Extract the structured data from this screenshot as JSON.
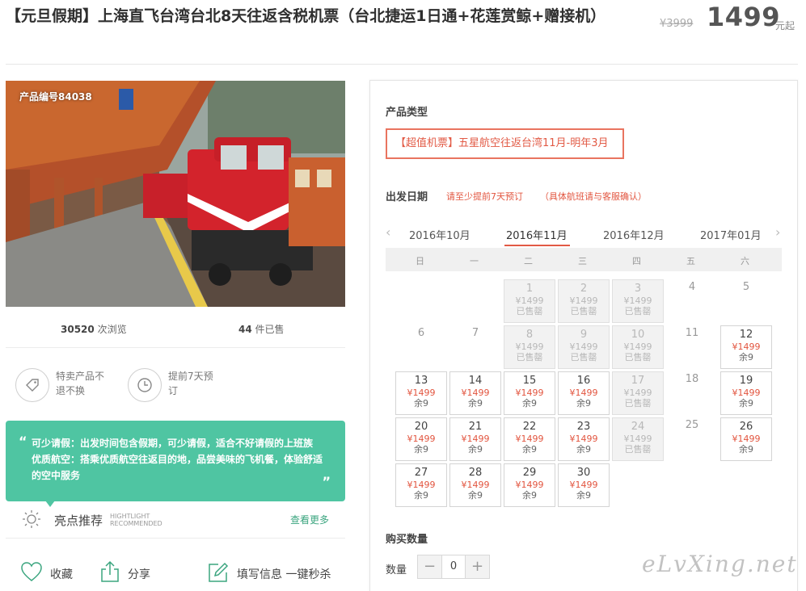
{
  "header": {
    "title": "【元旦假期】上海直飞台湾台北8天往返含税机票（台北捷运1日通+花莲赏鲸+赠接机）",
    "old_price": "¥3999",
    "price": "1499",
    "price_unit": "元起"
  },
  "product": {
    "number": "产品编号84038",
    "views": "30520",
    "views_label": "次浏览",
    "sold": "44",
    "sold_label": "件已售"
  },
  "features": [
    {
      "text": "特卖产品不退不换",
      "icon": "tag-icon"
    },
    {
      "text": "提前7天预订",
      "icon": "clock-icon"
    }
  ],
  "note": {
    "line1": "可少请假：出发时间包含假期，可少请假，适合不好请假的上班族",
    "line2": "优质航空：搭乘优质航空往返目的地，品尝美味的飞机餐，体验舒适的空中服务",
    "open_quote": "“",
    "close_quote": "”"
  },
  "highlight": {
    "title": "亮点推荐",
    "en_line1": "HIGHTLIGHT",
    "en_line2": "RECOMMENDED",
    "more": "查看更多"
  },
  "actions": {
    "favorite": "收藏",
    "share": "分享",
    "fill": "填写信息 一键秒杀"
  },
  "booking": {
    "type_label": "产品类型",
    "type_option": "【超值机票】五星航空往返台湾11月-明年3月",
    "date_label": "出发日期",
    "tip1": "请至少提前7天预订",
    "tip2": "（具体航班请与客服确认）",
    "months": [
      "2016年10月",
      "2016年11月",
      "2016年12月",
      "2017年01月"
    ],
    "weekdays": [
      "日",
      "一",
      "二",
      "三",
      "四",
      "五",
      "六"
    ],
    "price_tag": "¥1499",
    "sold_out": "已售罄",
    "remain": "余9",
    "qty_section": "购买数量",
    "qty_label": "数量",
    "qty_value": "0",
    "minus": "−",
    "plus": "+"
  },
  "calendar": [
    {
      "day": "1",
      "state": "sold"
    },
    {
      "day": "2",
      "state": "sold"
    },
    {
      "day": "3",
      "state": "sold"
    },
    {
      "day": "4",
      "state": "plain"
    },
    {
      "day": "5",
      "state": "plain"
    },
    {
      "day": "6",
      "state": "plain"
    },
    {
      "day": "7",
      "state": "plain"
    },
    {
      "day": "8",
      "state": "sold"
    },
    {
      "day": "9",
      "state": "sold"
    },
    {
      "day": "10",
      "state": "sold"
    },
    {
      "day": "11",
      "state": "plain"
    },
    {
      "day": "12",
      "state": "avail"
    },
    {
      "day": "13",
      "state": "avail"
    },
    {
      "day": "14",
      "state": "avail"
    },
    {
      "day": "15",
      "state": "avail"
    },
    {
      "day": "16",
      "state": "avail"
    },
    {
      "day": "17",
      "state": "sold"
    },
    {
      "day": "18",
      "state": "plain"
    },
    {
      "day": "19",
      "state": "avail"
    },
    {
      "day": "20",
      "state": "avail"
    },
    {
      "day": "21",
      "state": "avail"
    },
    {
      "day": "22",
      "state": "avail"
    },
    {
      "day": "23",
      "state": "avail"
    },
    {
      "day": "24",
      "state": "sold"
    },
    {
      "day": "25",
      "state": "plain"
    },
    {
      "day": "26",
      "state": "avail"
    },
    {
      "day": "27",
      "state": "avail"
    },
    {
      "day": "28",
      "state": "avail"
    },
    {
      "day": "29",
      "state": "avail"
    },
    {
      "day": "30",
      "state": "avail"
    }
  ],
  "watermark": "eLvXing.net",
  "colors": {
    "accent": "#e25a45",
    "teal": "#4fc5a2",
    "link": "#3ba57f"
  }
}
